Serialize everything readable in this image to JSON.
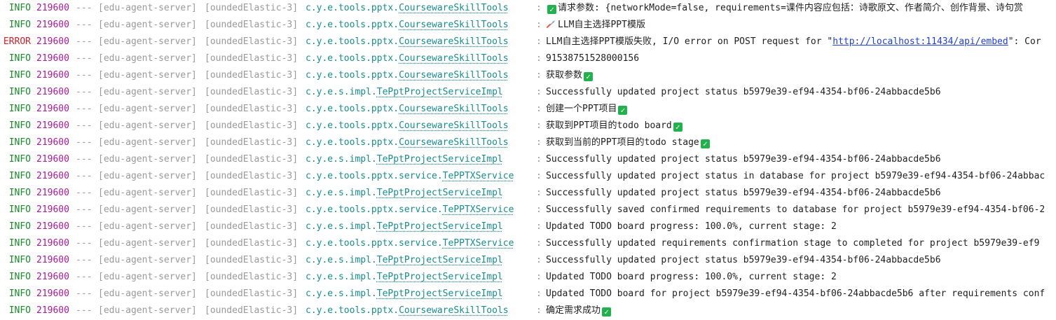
{
  "rows": [
    {
      "level": "INFO",
      "pid": "219600",
      "sep": "---",
      "app": "[edu-agent-server]",
      "thread": "[oundedElastic-3]",
      "pkg": "c.y.e.tools.pptx.",
      "cls": "CoursewareSkillTools",
      "colon": ":",
      "icon_before": "check-icon",
      "msg": "请求参数: {networkMode=false, requirements=课件内容应包括：诗歌原文、作者简介、创作背景、诗句赏",
      "icon_after": ""
    },
    {
      "level": "INFO",
      "pid": "219600",
      "sep": "---",
      "app": "[edu-agent-server]",
      "thread": "[oundedElastic-3]",
      "pkg": "c.y.e.tools.pptx.",
      "cls": "CoursewareSkillTools",
      "colon": ":",
      "icon_before": "rocket-icon",
      "msg": "LLM自主选择PPT模版",
      "icon_after": ""
    },
    {
      "level": "ERROR",
      "pid": "219600",
      "sep": "---",
      "app": "[edu-agent-server]",
      "thread": "[oundedElastic-3]",
      "pkg": "c.y.e.tools.pptx.",
      "cls": "CoursewareSkillTools",
      "colon": ":",
      "icon_before": "",
      "msg": "LLM自主选择PPT模版失败, I/O error on POST request for \"",
      "link": "http://localhost:11434/api/embed",
      "msg_tail": "\": Cor",
      "icon_after": ""
    },
    {
      "level": "INFO",
      "pid": "219600",
      "sep": "---",
      "app": "[edu-agent-server]",
      "thread": "[oundedElastic-3]",
      "pkg": "c.y.e.tools.pptx.",
      "cls": "CoursewareSkillTools",
      "colon": ":",
      "icon_before": "",
      "msg": "91538751528000156",
      "icon_after": ""
    },
    {
      "level": "INFO",
      "pid": "219600",
      "sep": "---",
      "app": "[edu-agent-server]",
      "thread": "[oundedElastic-3]",
      "pkg": "c.y.e.tools.pptx.",
      "cls": "CoursewareSkillTools",
      "colon": ":",
      "icon_before": "",
      "msg": "获取参数",
      "icon_after": "check-icon"
    },
    {
      "level": "INFO",
      "pid": "219600",
      "sep": "---",
      "app": "[edu-agent-server]",
      "thread": "[oundedElastic-3]",
      "pkg": "c.y.e.s.impl.",
      "cls": "TePptProjectServiceImpl",
      "colon": ":",
      "icon_before": "",
      "msg": "Successfully updated project status b5979e39-ef94-4354-bf06-24abbacde5b6",
      "icon_after": ""
    },
    {
      "level": "INFO",
      "pid": "219600",
      "sep": "---",
      "app": "[edu-agent-server]",
      "thread": "[oundedElastic-3]",
      "pkg": "c.y.e.tools.pptx.",
      "cls": "CoursewareSkillTools",
      "colon": ":",
      "icon_before": "",
      "msg": "创建一个PPT项目",
      "icon_after": "check-icon"
    },
    {
      "level": "INFO",
      "pid": "219600",
      "sep": "---",
      "app": "[edu-agent-server]",
      "thread": "[oundedElastic-3]",
      "pkg": "c.y.e.tools.pptx.",
      "cls": "CoursewareSkillTools",
      "colon": ":",
      "icon_before": "",
      "msg": "获取到PPT项目的todo board",
      "icon_after": "check-icon"
    },
    {
      "level": "INFO",
      "pid": "219600",
      "sep": "---",
      "app": "[edu-agent-server]",
      "thread": "[oundedElastic-3]",
      "pkg": "c.y.e.tools.pptx.",
      "cls": "CoursewareSkillTools",
      "colon": ":",
      "icon_before": "",
      "msg": "获取到当前的PPT项目的todo stage",
      "icon_after": "check-icon"
    },
    {
      "level": "INFO",
      "pid": "219600",
      "sep": "---",
      "app": "[edu-agent-server]",
      "thread": "[oundedElastic-3]",
      "pkg": "c.y.e.s.impl.",
      "cls": "TePptProjectServiceImpl",
      "colon": ":",
      "icon_before": "",
      "msg": "Successfully updated project status b5979e39-ef94-4354-bf06-24abbacde5b6",
      "icon_after": ""
    },
    {
      "level": "INFO",
      "pid": "219600",
      "sep": "---",
      "app": "[edu-agent-server]",
      "thread": "[oundedElastic-3]",
      "pkg": "c.y.e.tools.pptx.service.",
      "cls": "TePPTXService",
      "colon": ":",
      "icon_before": "",
      "msg": "Successfully updated project status in database for project b5979e39-ef94-4354-bf06-24abbac",
      "icon_after": ""
    },
    {
      "level": "INFO",
      "pid": "219600",
      "sep": "---",
      "app": "[edu-agent-server]",
      "thread": "[oundedElastic-3]",
      "pkg": "c.y.e.s.impl.",
      "cls": "TePptProjectServiceImpl",
      "colon": ":",
      "icon_before": "",
      "msg": "Successfully updated project status b5979e39-ef94-4354-bf06-24abbacde5b6",
      "icon_after": ""
    },
    {
      "level": "INFO",
      "pid": "219600",
      "sep": "---",
      "app": "[edu-agent-server]",
      "thread": "[oundedElastic-3]",
      "pkg": "c.y.e.tools.pptx.service.",
      "cls": "TePPTXService",
      "colon": ":",
      "icon_before": "",
      "msg": "Successfully saved confirmed requirements to database for project b5979e39-ef94-4354-bf06-2",
      "icon_after": ""
    },
    {
      "level": "INFO",
      "pid": "219600",
      "sep": "---",
      "app": "[edu-agent-server]",
      "thread": "[oundedElastic-3]",
      "pkg": "c.y.e.s.impl.",
      "cls": "TePptProjectServiceImpl",
      "colon": ":",
      "icon_before": "",
      "msg": "Updated TODO board progress: 100.0%, current stage: 2",
      "icon_after": ""
    },
    {
      "level": "INFO",
      "pid": "219600",
      "sep": "---",
      "app": "[edu-agent-server]",
      "thread": "[oundedElastic-3]",
      "pkg": "c.y.e.tools.pptx.service.",
      "cls": "TePPTXService",
      "colon": ":",
      "icon_before": "",
      "msg": "Successfully updated requirements confirmation stage to completed for project b5979e39-ef9",
      "icon_after": ""
    },
    {
      "level": "INFO",
      "pid": "219600",
      "sep": "---",
      "app": "[edu-agent-server]",
      "thread": "[oundedElastic-3]",
      "pkg": "c.y.e.s.impl.",
      "cls": "TePptProjectServiceImpl",
      "colon": ":",
      "icon_before": "",
      "msg": "Successfully updated project status b5979e39-ef94-4354-bf06-24abbacde5b6",
      "icon_after": ""
    },
    {
      "level": "INFO",
      "pid": "219600",
      "sep": "---",
      "app": "[edu-agent-server]",
      "thread": "[oundedElastic-3]",
      "pkg": "c.y.e.s.impl.",
      "cls": "TePptProjectServiceImpl",
      "colon": ":",
      "icon_before": "",
      "msg": "Updated TODO board progress: 100.0%, current stage: 2",
      "icon_after": ""
    },
    {
      "level": "INFO",
      "pid": "219600",
      "sep": "---",
      "app": "[edu-agent-server]",
      "thread": "[oundedElastic-3]",
      "pkg": "c.y.e.s.impl.",
      "cls": "TePptProjectServiceImpl",
      "colon": ":",
      "icon_before": "",
      "msg": "Updated TODO board for project b5979e39-ef94-4354-bf06-24abbacde5b6 after requirements conf",
      "icon_after": ""
    },
    {
      "level": "INFO",
      "pid": "219600",
      "sep": "---",
      "app": "[edu-agent-server]",
      "thread": "[oundedElastic-3]",
      "pkg": "c.y.e.tools.pptx.",
      "cls": "CoursewareSkillTools",
      "colon": ":",
      "icon_before": "",
      "msg": "确定需求成功",
      "icon_after": "check-icon"
    }
  ]
}
